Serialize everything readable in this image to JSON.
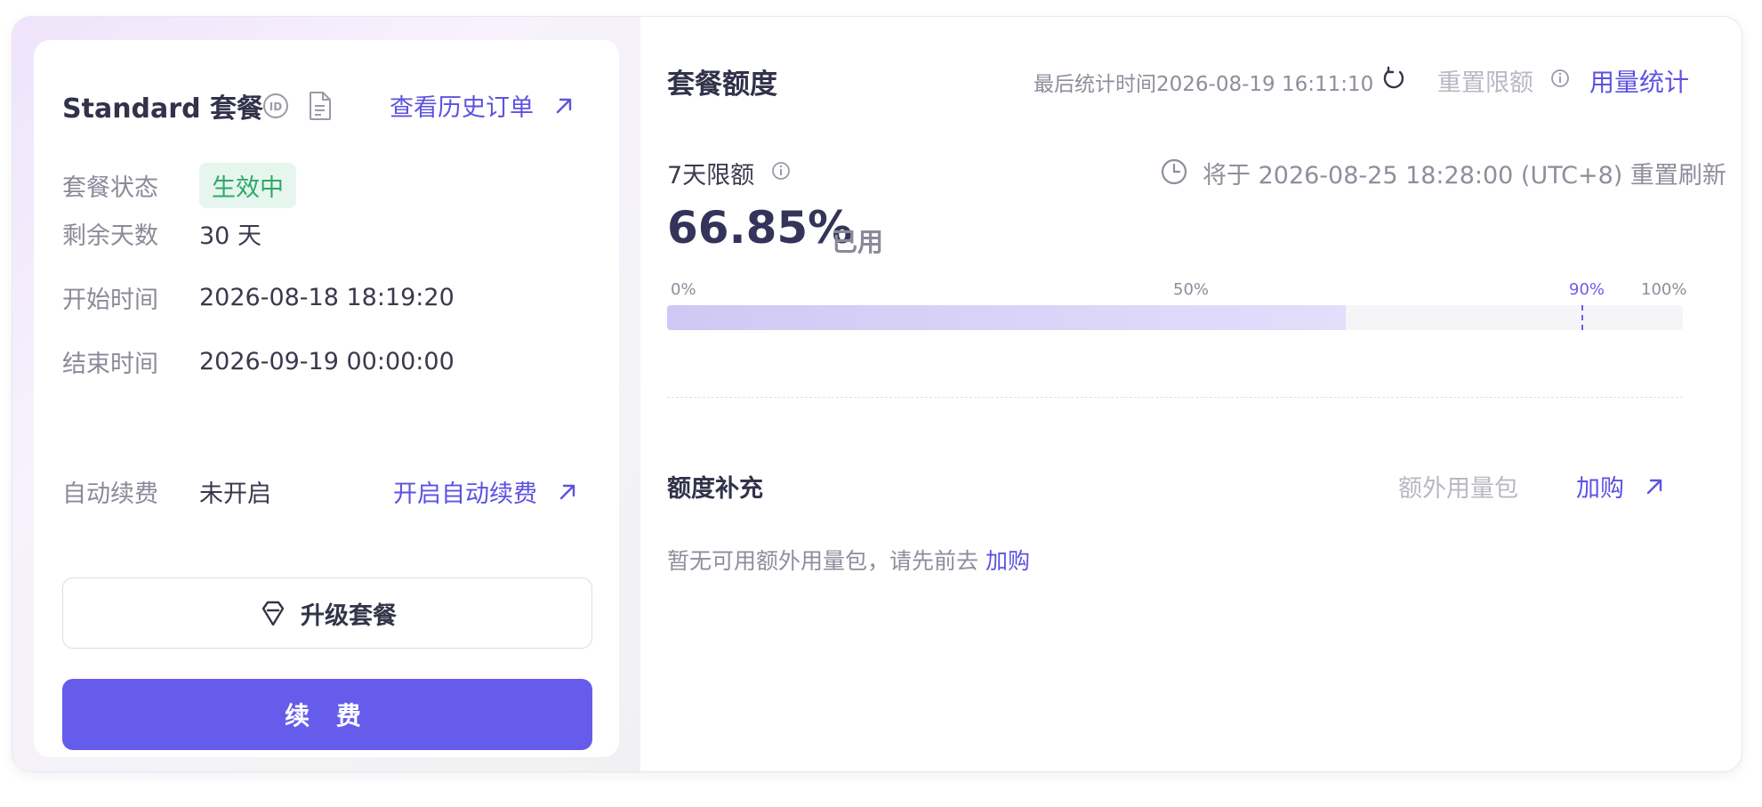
{
  "plan": {
    "title": "Standard 套餐",
    "history_link": "查看历史订单",
    "rows": {
      "status_label": "套餐状态",
      "status_value": "生效中",
      "days_label": "剩余天数",
      "days_value": "30 天",
      "start_label": "开始时间",
      "start_value": "2026-08-18 18:19:20",
      "end_label": "结束时间",
      "end_value": "2026-09-19 00:00:00",
      "auto_label": "自动续费",
      "auto_value": "未开启",
      "auto_link": "开启自动续费"
    },
    "upgrade_label": "升级套餐",
    "renew_label": "续 费"
  },
  "quota": {
    "title": "套餐额度",
    "last_stat": "最后统计时间2026-08-19 16:11:10",
    "reset_limit": "重置限额",
    "usage_link": "用量统计",
    "limit_label": "7天限额",
    "reset_time": "将于 2026-08-25 18:28:00 (UTC+8) 重置刷新",
    "percent": "66.85%",
    "used_label": "已用",
    "used_fraction": 0.6685,
    "marker_fraction": 0.9,
    "ticks": [
      "0%",
      "50%",
      "90%",
      "100%"
    ]
  },
  "supplement": {
    "title": "额度补充",
    "extra_pkg": "额外用量包",
    "buy_link": "加购",
    "empty_note": "暂无可用额外用量包，请先前去",
    "empty_link": "加购"
  },
  "colors": {
    "accent": "#655cec",
    "link": "#5d52e0",
    "success": "#2ea868"
  }
}
